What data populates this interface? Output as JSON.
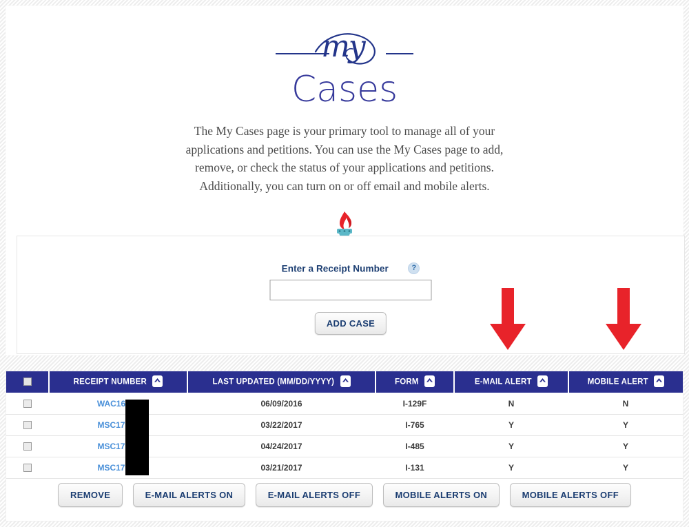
{
  "logo": {
    "script_text": "my",
    "title": "Cases"
  },
  "description": "The My Cases page is your primary tool to manage all of your applications and petitions. You can use the My Cases page to add, remove, or check the status of your applications and petitions. Additionally, you can turn on or off email and mobile alerts.",
  "torch_icon": "torch-icon",
  "receipt_section": {
    "label": "Enter a Receipt Number",
    "help_icon": "?",
    "input_value": "",
    "input_placeholder": "",
    "add_button": "ADD CASE"
  },
  "annotations": {
    "arrow_email": "down-arrow-icon",
    "arrow_mobile": "down-arrow-icon",
    "arrow_color": "#e8232a"
  },
  "table": {
    "select_all_checkbox": "",
    "columns": [
      {
        "label": "",
        "sort": "chevron-up-icon"
      },
      {
        "label": "RECEIPT NUMBER",
        "sort": "chevron-up-icon"
      },
      {
        "label": "LAST UPDATED (MM/DD/YYYY)",
        "sort": "chevron-up-icon"
      },
      {
        "label": "FORM",
        "sort": "chevron-up-icon"
      },
      {
        "label": "E-MAIL ALERT",
        "sort": "chevron-up-icon"
      },
      {
        "label": "MOBILE ALERT",
        "sort": "chevron-up-icon"
      }
    ],
    "rows": [
      {
        "receipt": "WAC16903",
        "updated": "06/09/2016",
        "form": "I-129F",
        "email_alert": "N",
        "mobile_alert": "N"
      },
      {
        "receipt": "MSC17904",
        "updated": "03/22/2017",
        "form": "I-765",
        "email_alert": "Y",
        "mobile_alert": "Y"
      },
      {
        "receipt": "MSC17904",
        "updated": "04/24/2017",
        "form": "I-485",
        "email_alert": "Y",
        "mobile_alert": "Y"
      },
      {
        "receipt": "MSC17904",
        "updated": "03/21/2017",
        "form": "I-131",
        "email_alert": "Y",
        "mobile_alert": "Y"
      }
    ]
  },
  "actions": [
    "REMOVE",
    "E-MAIL ALERTS ON",
    "E-MAIL ALERTS OFF",
    "MOBILE ALERTS ON",
    "MOBILE ALERTS OFF"
  ],
  "colors": {
    "header_navy": "#2a2f8f",
    "logo_blue": "#36399b",
    "link_blue": "#4a90d9",
    "arrow_red": "#e8232a",
    "torch_flame": "#e8232a",
    "torch_base": "#5bb8c8"
  }
}
